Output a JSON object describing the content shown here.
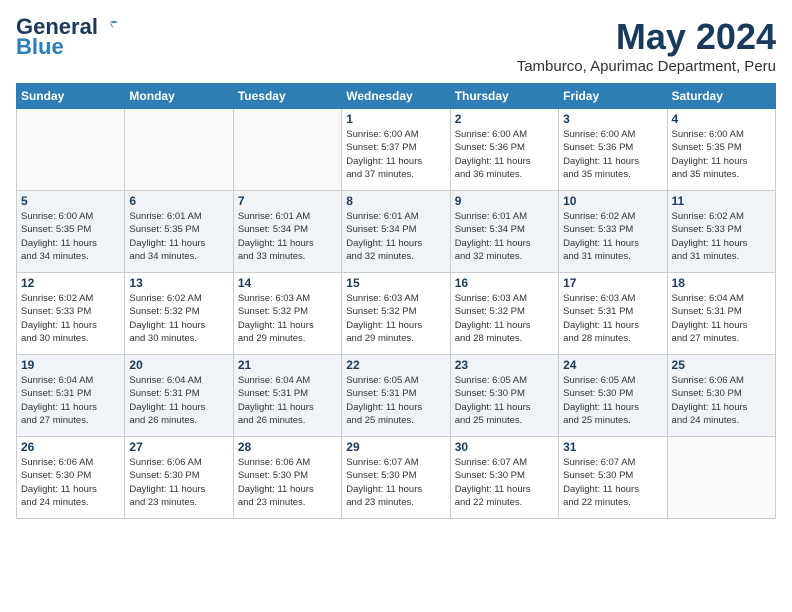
{
  "header": {
    "logo_line1": "General",
    "logo_line2": "Blue",
    "month_year": "May 2024",
    "location": "Tamburco, Apurimac Department, Peru"
  },
  "days_of_week": [
    "Sunday",
    "Monday",
    "Tuesday",
    "Wednesday",
    "Thursday",
    "Friday",
    "Saturday"
  ],
  "weeks": [
    [
      {
        "day": "",
        "info": ""
      },
      {
        "day": "",
        "info": ""
      },
      {
        "day": "",
        "info": ""
      },
      {
        "day": "1",
        "info": "Sunrise: 6:00 AM\nSunset: 5:37 PM\nDaylight: 11 hours\nand 37 minutes."
      },
      {
        "day": "2",
        "info": "Sunrise: 6:00 AM\nSunset: 5:36 PM\nDaylight: 11 hours\nand 36 minutes."
      },
      {
        "day": "3",
        "info": "Sunrise: 6:00 AM\nSunset: 5:36 PM\nDaylight: 11 hours\nand 35 minutes."
      },
      {
        "day": "4",
        "info": "Sunrise: 6:00 AM\nSunset: 5:35 PM\nDaylight: 11 hours\nand 35 minutes."
      }
    ],
    [
      {
        "day": "5",
        "info": "Sunrise: 6:00 AM\nSunset: 5:35 PM\nDaylight: 11 hours\nand 34 minutes."
      },
      {
        "day": "6",
        "info": "Sunrise: 6:01 AM\nSunset: 5:35 PM\nDaylight: 11 hours\nand 34 minutes."
      },
      {
        "day": "7",
        "info": "Sunrise: 6:01 AM\nSunset: 5:34 PM\nDaylight: 11 hours\nand 33 minutes."
      },
      {
        "day": "8",
        "info": "Sunrise: 6:01 AM\nSunset: 5:34 PM\nDaylight: 11 hours\nand 32 minutes."
      },
      {
        "day": "9",
        "info": "Sunrise: 6:01 AM\nSunset: 5:34 PM\nDaylight: 11 hours\nand 32 minutes."
      },
      {
        "day": "10",
        "info": "Sunrise: 6:02 AM\nSunset: 5:33 PM\nDaylight: 11 hours\nand 31 minutes."
      },
      {
        "day": "11",
        "info": "Sunrise: 6:02 AM\nSunset: 5:33 PM\nDaylight: 11 hours\nand 31 minutes."
      }
    ],
    [
      {
        "day": "12",
        "info": "Sunrise: 6:02 AM\nSunset: 5:33 PM\nDaylight: 11 hours\nand 30 minutes."
      },
      {
        "day": "13",
        "info": "Sunrise: 6:02 AM\nSunset: 5:32 PM\nDaylight: 11 hours\nand 30 minutes."
      },
      {
        "day": "14",
        "info": "Sunrise: 6:03 AM\nSunset: 5:32 PM\nDaylight: 11 hours\nand 29 minutes."
      },
      {
        "day": "15",
        "info": "Sunrise: 6:03 AM\nSunset: 5:32 PM\nDaylight: 11 hours\nand 29 minutes."
      },
      {
        "day": "16",
        "info": "Sunrise: 6:03 AM\nSunset: 5:32 PM\nDaylight: 11 hours\nand 28 minutes."
      },
      {
        "day": "17",
        "info": "Sunrise: 6:03 AM\nSunset: 5:31 PM\nDaylight: 11 hours\nand 28 minutes."
      },
      {
        "day": "18",
        "info": "Sunrise: 6:04 AM\nSunset: 5:31 PM\nDaylight: 11 hours\nand 27 minutes."
      }
    ],
    [
      {
        "day": "19",
        "info": "Sunrise: 6:04 AM\nSunset: 5:31 PM\nDaylight: 11 hours\nand 27 minutes."
      },
      {
        "day": "20",
        "info": "Sunrise: 6:04 AM\nSunset: 5:31 PM\nDaylight: 11 hours\nand 26 minutes."
      },
      {
        "day": "21",
        "info": "Sunrise: 6:04 AM\nSunset: 5:31 PM\nDaylight: 11 hours\nand 26 minutes."
      },
      {
        "day": "22",
        "info": "Sunrise: 6:05 AM\nSunset: 5:31 PM\nDaylight: 11 hours\nand 25 minutes."
      },
      {
        "day": "23",
        "info": "Sunrise: 6:05 AM\nSunset: 5:30 PM\nDaylight: 11 hours\nand 25 minutes."
      },
      {
        "day": "24",
        "info": "Sunrise: 6:05 AM\nSunset: 5:30 PM\nDaylight: 11 hours\nand 25 minutes."
      },
      {
        "day": "25",
        "info": "Sunrise: 6:06 AM\nSunset: 5:30 PM\nDaylight: 11 hours\nand 24 minutes."
      }
    ],
    [
      {
        "day": "26",
        "info": "Sunrise: 6:06 AM\nSunset: 5:30 PM\nDaylight: 11 hours\nand 24 minutes."
      },
      {
        "day": "27",
        "info": "Sunrise: 6:06 AM\nSunset: 5:30 PM\nDaylight: 11 hours\nand 23 minutes."
      },
      {
        "day": "28",
        "info": "Sunrise: 6:06 AM\nSunset: 5:30 PM\nDaylight: 11 hours\nand 23 minutes."
      },
      {
        "day": "29",
        "info": "Sunrise: 6:07 AM\nSunset: 5:30 PM\nDaylight: 11 hours\nand 23 minutes."
      },
      {
        "day": "30",
        "info": "Sunrise: 6:07 AM\nSunset: 5:30 PM\nDaylight: 11 hours\nand 22 minutes."
      },
      {
        "day": "31",
        "info": "Sunrise: 6:07 AM\nSunset: 5:30 PM\nDaylight: 11 hours\nand 22 minutes."
      },
      {
        "day": "",
        "info": ""
      }
    ]
  ]
}
